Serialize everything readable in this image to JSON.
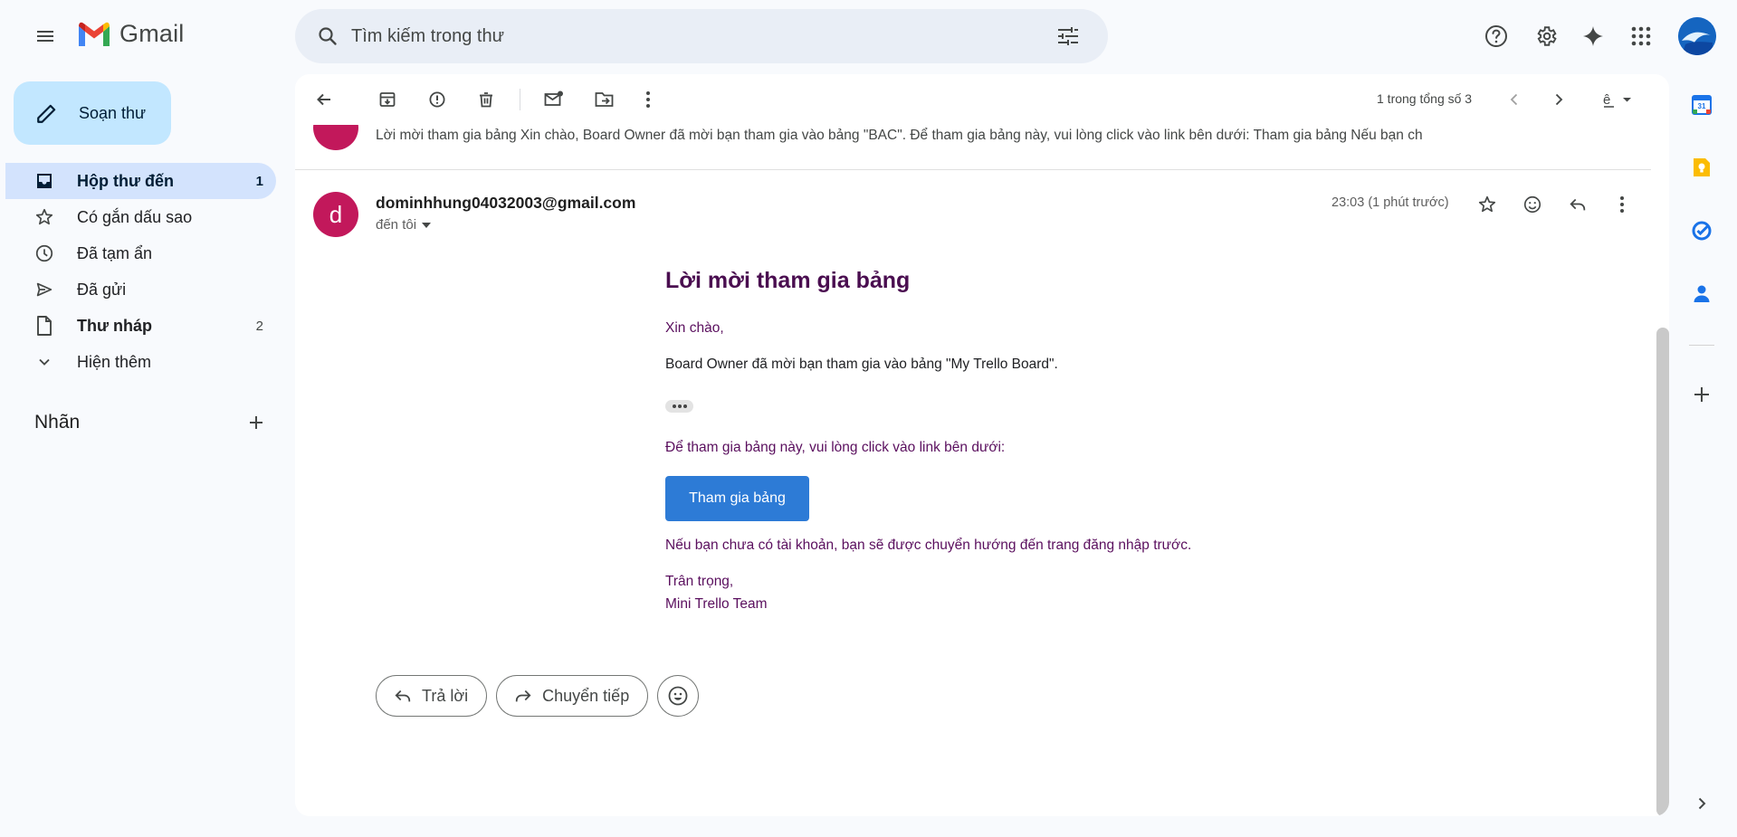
{
  "app": {
    "name": "Gmail"
  },
  "search": {
    "placeholder": "Tìm kiếm trong thư"
  },
  "compose": {
    "label": "Soạn thư"
  },
  "nav": {
    "items": [
      {
        "label": "Hộp thư đến",
        "count": "1",
        "icon": "inbox-icon"
      },
      {
        "label": "Có gắn dấu sao",
        "count": "",
        "icon": "star-icon"
      },
      {
        "label": "Đã tạm ẩn",
        "count": "",
        "icon": "clock-icon"
      },
      {
        "label": "Đã gửi",
        "count": "",
        "icon": "send-icon"
      },
      {
        "label": "Thư nháp",
        "count": "2",
        "icon": "draft-icon"
      },
      {
        "label": "Hiện thêm",
        "count": "",
        "icon": "chevron-down-icon"
      }
    ]
  },
  "labels": {
    "title": "Nhãn"
  },
  "toolbar": {
    "pager": "1 trong tổng số 3"
  },
  "thread": {
    "previous_snippet": "Lời mời tham gia bảng Xin chào, Board Owner đã mời bạn tham gia vào bảng \"BAC\". Để tham gia bảng này, vui lòng click vào link bên dưới: Tham gia bảng Nếu bạn ch",
    "message": {
      "avatar_letter": "d",
      "sender": "dominhhung04032003@gmail.com",
      "to": "đến tôi",
      "time": "23:03 (1 phút trước)",
      "body": {
        "title": "Lời mời tham gia bảng",
        "greeting": "Xin chào,",
        "invite": "Board Owner đã mời bạn tham gia vào bảng \"My Trello Board\".",
        "join_instruction": "Để tham gia bảng này, vui lòng click vào link bên dưới:",
        "join_button": "Tham gia bảng",
        "note": "Nếu bạn chưa có tài khoản, bạn sẽ được chuyển hướng đến trang đăng nhập trước.",
        "regards": "Trân trọng,",
        "team": "Mini Trello Team"
      }
    }
  },
  "actions": {
    "reply": "Trả lời",
    "forward": "Chuyển tiếp"
  },
  "colors": {
    "accent": "#c2e7ff",
    "active_nav": "#d3e3fd",
    "avatar": "#c2185b",
    "button": "#2d7bd6",
    "body_text": "#5a0f5e"
  }
}
